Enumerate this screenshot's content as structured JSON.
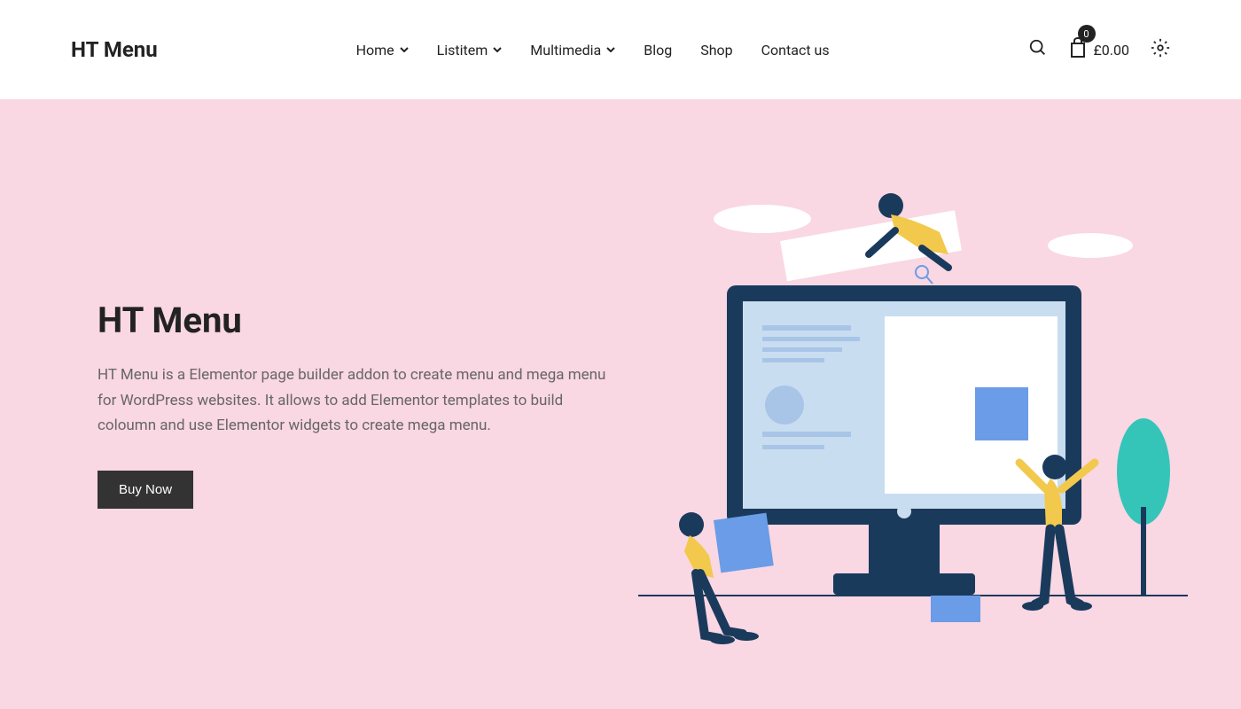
{
  "logo": "HT Menu",
  "nav": {
    "items": [
      {
        "label": "Home",
        "dropdown": true
      },
      {
        "label": "Listitem",
        "dropdown": true
      },
      {
        "label": "Multimedia",
        "dropdown": true
      },
      {
        "label": "Blog",
        "dropdown": false
      },
      {
        "label": "Shop",
        "dropdown": false
      },
      {
        "label": "Contact us",
        "dropdown": false
      }
    ]
  },
  "cart": {
    "badge": "0",
    "price": "£0.00"
  },
  "hero": {
    "title": "HT Menu",
    "desc": "HT Menu is a Elementor page builder addon to create menu and mega menu for WordPress websites. It allows to add Elementor templates to build coloumn and use Elementor widgets to create mega menu.",
    "cta": "Buy Now"
  }
}
